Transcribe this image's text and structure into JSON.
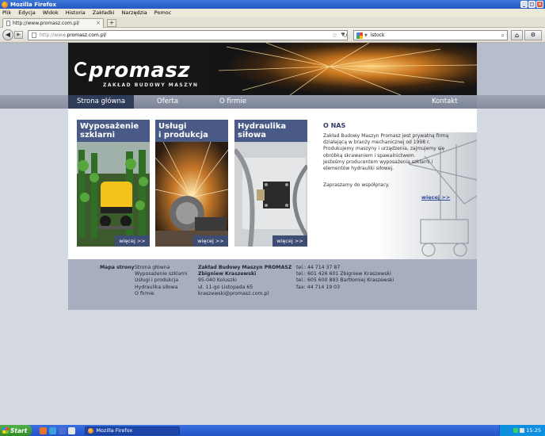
{
  "window": {
    "title": "Mozilla Firefox"
  },
  "menu": [
    "Plik",
    "Edycja",
    "Widok",
    "Historia",
    "Zakładki",
    "Narzędzia",
    "Pomoc"
  ],
  "tab": {
    "label": "http://www.promasz.com.pl/"
  },
  "address": {
    "prefix": "http://www.",
    "host": "promasz.com.pl/"
  },
  "search": {
    "value": "istock"
  },
  "site": {
    "brand": "promasz",
    "tagline": "ZAKŁAD BUDOWY MASZYN",
    "nav": [
      "Strona główna",
      "Oferta",
      "O firmie",
      "Kontakt"
    ],
    "cards": [
      {
        "title_line1": "Wyposażenie",
        "title_line2": "szklarni",
        "more": "więcej >>"
      },
      {
        "title_line1": "Usługi",
        "title_line2": "i produkcja",
        "more": "więcej >>"
      },
      {
        "title_line1": "Hydraulika",
        "title_line2": "siłowa",
        "more": "więcej >>"
      }
    ],
    "about": {
      "title": "O NAS",
      "lines": [
        "Zakład Budowy Maszyn Promasz jest prywatną firmą",
        "działającą w branży mechanicznej od 1998 r.",
        "Produkujemy maszyny i urządzenia, zajmujemy się",
        "obróbką skrawaniem i spawalnictwem.",
        "Jesteśmy producentem wyposażenia szklarni i",
        "elementów hydrauliki siłowej."
      ],
      "invite": "Zapraszamy do współpracy.",
      "more": "więcej >>"
    },
    "footer": {
      "sitemap_title": "Mapa strony",
      "sitemap": [
        "Strona główna",
        "Wyposażenie szklarni",
        "Usługi i produkcja",
        "Hydraulika siłowa",
        "O firmie"
      ],
      "company_name": "Zakład Budowy Maszyn PROMASZ",
      "owner": "Zbigniew Kraszewski",
      "address_lines": [
        "95-040 Koluszki",
        "ul. 11-go Listopada 65",
        "kraszewski@promasz.com.pl"
      ],
      "phones": [
        "tel.: 44 714 37 87",
        "tel.: 601 426 601 Zbigniew Kraszewski",
        "tel.: 605 600 893 Bartłomiej Kraszewski",
        "fax: 44 714 19 03"
      ]
    }
  },
  "taskbar": {
    "start": "Start",
    "task": "Mozilla Firefox",
    "clock": "15:25"
  }
}
